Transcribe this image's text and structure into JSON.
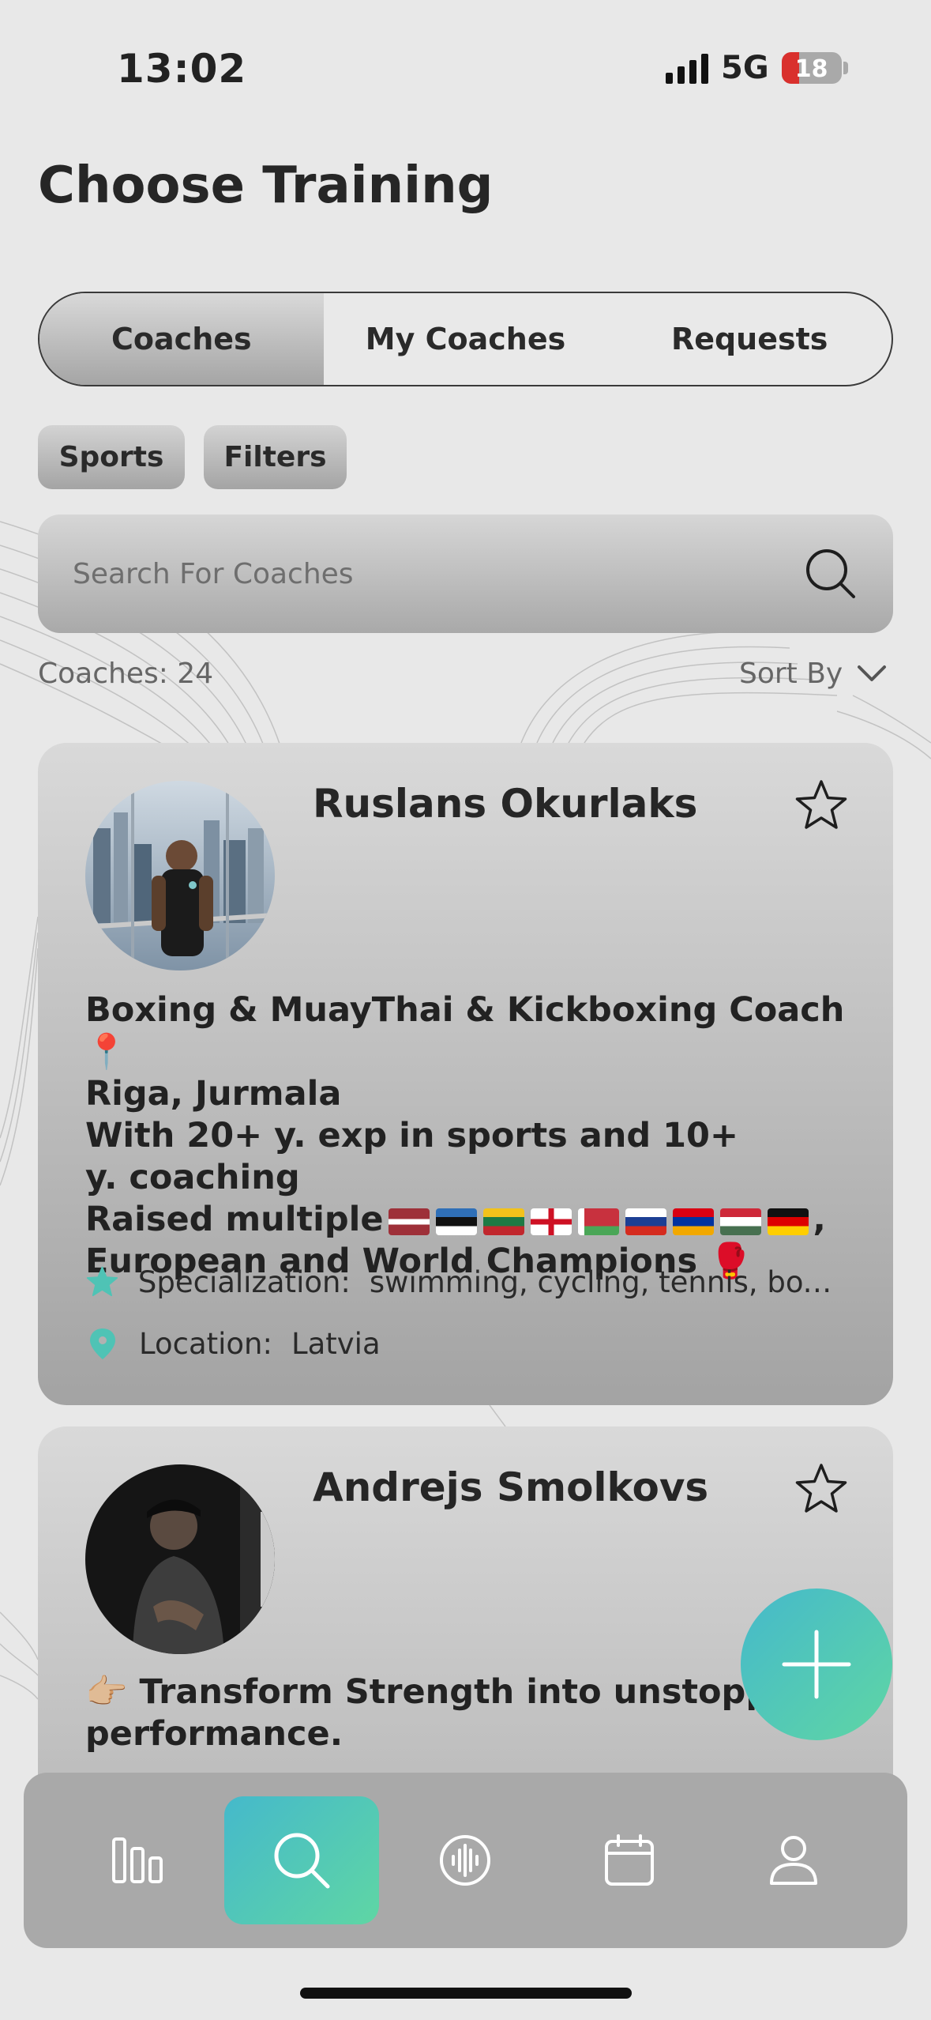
{
  "status": {
    "time": "13:02",
    "network": "5G",
    "battery": "18"
  },
  "page": {
    "title": "Choose Training"
  },
  "tabs": [
    {
      "label": "Coaches",
      "active": true
    },
    {
      "label": "My Coaches",
      "active": false
    },
    {
      "label": "Requests",
      "active": false
    }
  ],
  "filters": {
    "sports": "Sports",
    "filters": "Filters"
  },
  "search": {
    "placeholder": "Search For Coaches"
  },
  "list": {
    "count_label": "Coaches: 24",
    "sort_label": "Sort By"
  },
  "coaches": [
    {
      "name": "Ruslans Okurlaks",
      "bio_line1": "Boxing & MuayThai & Kickboxing Coach 📍",
      "bio_line2": "Riga, Jurmala",
      "bio_line3": "With 20+ y. exp in sports and 10+",
      "bio_line4": "y. coaching",
      "bio_line5a": "Raised multiple",
      "bio_line5b": ",",
      "bio_line6": "European and World Champions 🥊",
      "specialization_label": "Specialization:",
      "specialization_value": "swimming, cycling, tennis, boxi...",
      "location_label": "Location:",
      "location_value": "Latvia"
    },
    {
      "name": "Andrejs Smolkovs",
      "bio": "👉🏼 Transform Strength into unstoppab... performance.",
      "bio_line1": "👉🏼 Transform Strength into unstoppab",
      "bio_line2": "performance."
    }
  ],
  "nav": [
    "stats-icon",
    "search-icon",
    "voice-icon",
    "calendar-icon",
    "profile-icon"
  ],
  "colors": {
    "accent_start": "#45b9cb",
    "accent_end": "#5fd6a4",
    "battery_low": "#d9302d"
  }
}
